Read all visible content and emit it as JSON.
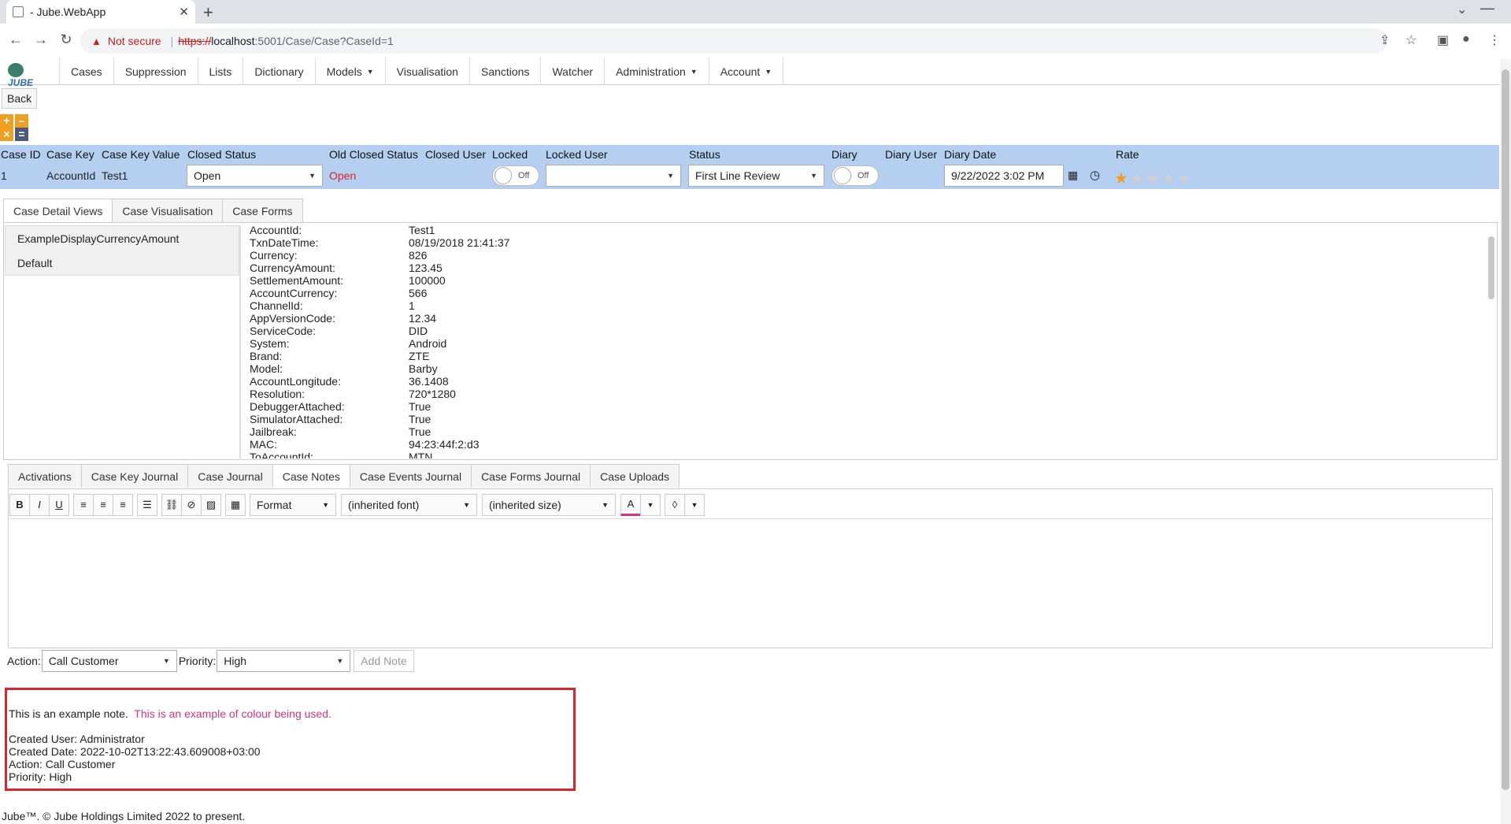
{
  "browser": {
    "tab_title": "- Jube.WebApp",
    "new_tab": "+",
    "not_secure": "Not secure",
    "url_scheme": "https://",
    "url_host": "localhost",
    "url_path": ":5001/Case/Case?CaseId=1"
  },
  "app": {
    "logo": "JUBE",
    "menu": [
      {
        "label": "Cases"
      },
      {
        "label": "Suppression"
      },
      {
        "label": "Lists"
      },
      {
        "label": "Dictionary"
      },
      {
        "label": "Models",
        "caret": "▼"
      },
      {
        "label": "Visualisation"
      },
      {
        "label": "Sanctions"
      },
      {
        "label": "Watcher"
      },
      {
        "label": "Administration",
        "caret": "▼"
      },
      {
        "label": "Account",
        "caret": "▼"
      }
    ],
    "back_label": "Back",
    "mini_buttons": {
      "plus": "+",
      "minus": "–",
      "close": "×",
      "equals": "="
    }
  },
  "case_header": {
    "labels": {
      "case_id": "Case ID",
      "case_key": "Case Key",
      "case_key_value": "Case Key Value",
      "closed_status": "Closed Status",
      "old_closed_status": "Old Closed Status",
      "closed_user": "Closed User",
      "locked": "Locked",
      "locked_user": "Locked User",
      "status": "Status",
      "diary": "Diary",
      "diary_user": "Diary User",
      "diary_date": "Diary Date",
      "rate": "Rate"
    },
    "values": {
      "case_id": "1",
      "case_key": "AccountId",
      "case_key_value": "Test1",
      "closed_status": "Open",
      "old_closed_status": "Open",
      "locked": "Off",
      "locked_user": "",
      "status": "First Line Review",
      "diary": "Off",
      "diary_date": "9/22/2022 3:02 PM"
    },
    "rating": {
      "value": 1,
      "max": 5
    },
    "colors": {
      "bar": "#b4cff0",
      "old_status": "#d9252a"
    }
  },
  "detail_tabs": [
    {
      "label": "Case Detail Views",
      "active": true
    },
    {
      "label": "Case Visualisation"
    },
    {
      "label": "Case Forms"
    }
  ],
  "views": [
    "ExampleDisplayCurrencyAmount",
    "Default"
  ],
  "fields": [
    {
      "k": "AccountId:",
      "v": "Test1"
    },
    {
      "k": "TxnDateTime:",
      "v": "08/19/2018 21:41:37"
    },
    {
      "k": "Currency:",
      "v": "826"
    },
    {
      "k": "CurrencyAmount:",
      "v": "123.45"
    },
    {
      "k": "SettlementAmount:",
      "v": "100000"
    },
    {
      "k": "AccountCurrency:",
      "v": "566"
    },
    {
      "k": "ChannelId:",
      "v": "1"
    },
    {
      "k": "AppVersionCode:",
      "v": "12.34"
    },
    {
      "k": "ServiceCode:",
      "v": "DID"
    },
    {
      "k": "System:",
      "v": "Android"
    },
    {
      "k": "Brand:",
      "v": "ZTE"
    },
    {
      "k": "Model:",
      "v": "Barby"
    },
    {
      "k": "AccountLongitude:",
      "v": "36.1408"
    },
    {
      "k": "Resolution:",
      "v": "720*1280"
    },
    {
      "k": "DebuggerAttached:",
      "v": "True"
    },
    {
      "k": "SimulatorAttached:",
      "v": "True"
    },
    {
      "k": "Jailbreak:",
      "v": "True"
    },
    {
      "k": "MAC:",
      "v": "94:23:44f:2:d3"
    },
    {
      "k": "ToAccountId:",
      "v": "MTN"
    }
  ],
  "bottom_tabs": [
    {
      "label": "Activations"
    },
    {
      "label": "Case Key Journal"
    },
    {
      "label": "Case Journal"
    },
    {
      "label": "Case Notes",
      "active": true
    },
    {
      "label": "Case Events Journal"
    },
    {
      "label": "Case Forms Journal"
    },
    {
      "label": "Case Uploads"
    }
  ],
  "editor": {
    "buttons": {
      "bold": "B",
      "italic": "I",
      "underline": "U",
      "text_color": "A"
    },
    "format": "Format",
    "font": "(inherited font)",
    "size": "(inherited size)"
  },
  "note_form": {
    "action_label": "Action:",
    "action_value": "Call Customer",
    "priority_label": "Priority:",
    "priority_value": "High",
    "add_note": "Add Note"
  },
  "note": {
    "text": "This is an example note.",
    "colored_text": "This is an example of colour being used.",
    "created_user": "Created User: Administrator",
    "created_date": "Created Date: 2022-10-02T13:22:43.609008+03:00",
    "action": "Action: Call Customer",
    "priority": "Priority: High",
    "colors": {
      "highlight_border": "#d9252a",
      "colored_text": "#d63384"
    }
  },
  "footer": "Jube™. © Jube Holdings Limited 2022 to present."
}
